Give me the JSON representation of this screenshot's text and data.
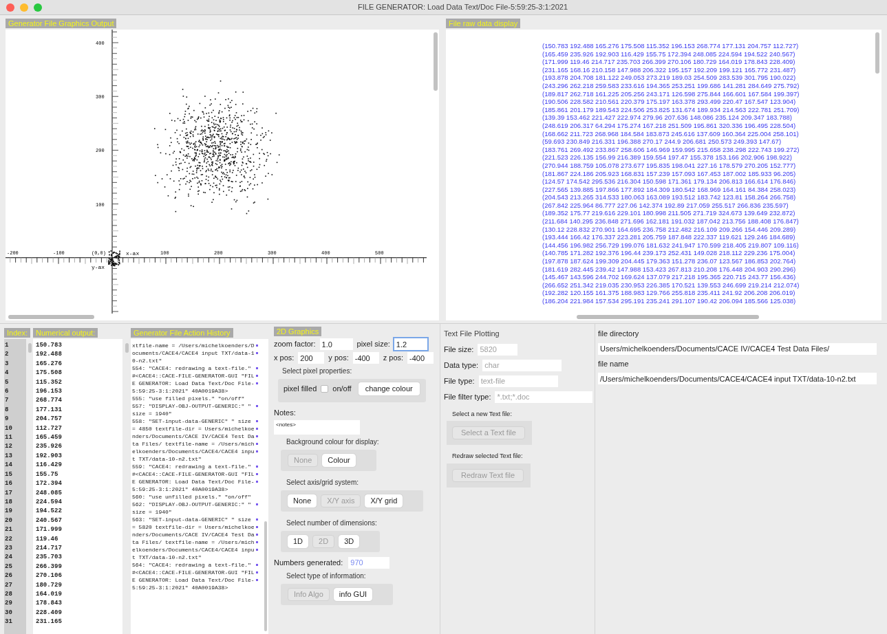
{
  "window": {
    "title": "FILE GENERATOR: Load Data Text/Doc File-5:59:25-3:1:2021"
  },
  "graphics": {
    "title": "Generator File Graphics Output",
    "x_tick_labels": [
      "-200",
      "-100",
      "100",
      "200",
      "300",
      "400",
      "500"
    ],
    "y_tick_labels": [
      "400",
      "300",
      "200",
      "100"
    ],
    "origin_label": "(0,0)",
    "x_axis_label": "x-ax",
    "y_axis_label": "y-ax"
  },
  "raw_data": {
    "title": "File raw data display",
    "lines": [
      "(150.783 192.488 165.276 175.508 115.352 196.153 268.774 177.131 204.757 112.727)",
      "(165.459 235.926 192.903 116.429 155.75 172.394 248.085 224.594 194.522 240.567)",
      "(171.999 119.46 214.717 235.703 266.399 270.106 180.729 164.019 178.843 228.409)",
      "(231.165 168.16 210.158 147.988 206.322 195.157 192.209 199.121 165.772 231.487)",
      "(193.878 204.708 181.122 249.053 273.219 189.03 254.509 283.539 301.795 190.022)",
      "(243.296 262.218 259.583 233.616 194.365 253.251 199.686 141.281 284.649 275.792)",
      "(189.817 262.718 161.225 205.256 243.171 126.598 275.844 166.601 167.584 199.397)",
      "(190.506 228.582 210.561 220.379 175.197 163.378 293.499 220.47 167.547 123.904)",
      "(185.861 201.179 189.543 224.506 253.825 131.674 189.934 214.563 222.781 251.709)",
      "(139.39 153.462 221.427 222.974 279.96 207.636 148.086 235.124 209.347 183.788)",
      "(248.619 206.317 64.294 175.274 167.218 251.509 195.861 320.336 196.495 228.504)",
      "(168.662 211.723 268.968 184.584 183.873 245.616 137.609 160.364 225.004 258.101)",
      "(59.693 230.849 216.331 196.388 270.17 244.9 206.681 250.573 249.393 147.67)",
      "(183.761 269.492 233.867 258.606 146.969 159.995 215.658 238.298 222.743 199.272)",
      "(221.523 226.135 156.99 216.389 159.554 197.47 155.378 153.166 202.906 198.922)",
      "(270.944 188.759 105.078 273.677 195.835 198.041 227.16 178.579 270.205 152.777)",
      "(181.867 224.186 205.923 168.831 157.239 157.093 167.453 187.002 185.933 96.205)",
      "(124.57 174.542 295.536 216.304 150.598 171.361 179.134 206.813 166.614 176.846)",
      "(227.565 139.885 197.866 177.892 184.309 180.542 168.969 164.161 84.384 258.023)",
      "(204.543 213.265 314.533 180.063 163.089 193.512 183.742 123.81 158.264 266.758)",
      "(267.842 225.964 86.777 227.06 142.374 192.89 217.059 255.517 266.836 235.597)",
      "(189.352 175.77 219.616 229.101 180.998 211.505 271.719 324.673 139.649 232.872)",
      "(211.684 140.295 236.848 271.696 162.181 191.032 187.042 213.756 188.408 176.847)",
      "(130.12 228.832 270.901 164.695 236.758 212.482 216.109 209.266 154.446 209.289)",
      "(193.444 166.42 176.337 223.281 205.759 187.848 222.337 119.621 129.246 184.689)",
      "(144.456 196.982 256.729 199.076 181.632 241.947 170.599 218.405 219.807 109.116)",
      "(140.785 171.282 192.376 196.44 239.173 252.431 149.028 218.112 229.236 175.004)",
      "(197.878 187.624 199.309 204.445 179.363 151.278 236.07 123.567 186.853 202.764)",
      "(181.619 282.445 239.42 147.988 153.423 267.813 210.208 176.448 204.903 290.296)",
      "(145.467 143.596 244.702 169.624 137.079 217.218 195.365 220.715 243.77 156.436)",
      "(266.652 251.342 219.035 230.953 226.385 170.521 139.553 246.699 219.214 212.074)",
      "(192.282 120.155 161.375 188.983 129.766 255.818 235.411 241.92 206.208 206.019)",
      "(186.204 221.984 157.534 295.191 235.241 291.107 190.42 206.094 185.566 125.038)"
    ]
  },
  "output": {
    "index_title": "Index:",
    "values_title": "Numerical output:",
    "rows": [
      {
        "index": "1",
        "value": "150.783"
      },
      {
        "index": "2",
        "value": "192.488"
      },
      {
        "index": "3",
        "value": "165.276"
      },
      {
        "index": "4",
        "value": "175.508"
      },
      {
        "index": "5",
        "value": "115.352"
      },
      {
        "index": "6",
        "value": "196.153"
      },
      {
        "index": "7",
        "value": "268.774"
      },
      {
        "index": "8",
        "value": "177.131"
      },
      {
        "index": "9",
        "value": "204.757"
      },
      {
        "index": "10",
        "value": "112.727"
      },
      {
        "index": "11",
        "value": "165.459"
      },
      {
        "index": "12",
        "value": "235.926"
      },
      {
        "index": "13",
        "value": "192.903"
      },
      {
        "index": "14",
        "value": "116.429"
      },
      {
        "index": "15",
        "value": "155.75"
      },
      {
        "index": "16",
        "value": "172.394"
      },
      {
        "index": "17",
        "value": "248.085"
      },
      {
        "index": "18",
        "value": "224.594"
      },
      {
        "index": "19",
        "value": "194.522"
      },
      {
        "index": "20",
        "value": "240.567"
      },
      {
        "index": "21",
        "value": "171.999"
      },
      {
        "index": "22",
        "value": "119.46"
      },
      {
        "index": "23",
        "value": "214.717"
      },
      {
        "index": "24",
        "value": "235.703"
      },
      {
        "index": "25",
        "value": "266.399"
      },
      {
        "index": "26",
        "value": "270.106"
      },
      {
        "index": "27",
        "value": "180.729"
      },
      {
        "index": "28",
        "value": "164.019"
      },
      {
        "index": "29",
        "value": "178.843"
      },
      {
        "index": "30",
        "value": "228.409"
      },
      {
        "index": "31",
        "value": "231.165"
      }
    ]
  },
  "history": {
    "title": "Generator File Action History",
    "lines": [
      {
        "text": "xtfile-name = /Users/michelkoenders/D",
        "wrapped": true
      },
      {
        "text": "ocuments/CACE4/CACE4 input TXT/data-1",
        "wrapped": true
      },
      {
        "text": "0-n2.txt\"",
        "wrapped": false
      },
      {
        "text": "554: \"CACE4: redrawing a text-file.\"",
        "wrapped": true
      },
      {
        "text": "#<CACE4::CACE-FILE-GENERATOR-GUI \"FIL",
        "wrapped": true
      },
      {
        "text": "E GENERATOR: Load Data Text/Doc File-",
        "wrapped": true
      },
      {
        "text": "5:59:25-3:1:2021\" 40A0019A38>",
        "wrapped": false
      },
      {
        "text": "555: \"use filled pixels.\" \"on/off\"",
        "wrapped": false
      },
      {
        "text": "557: \"DISPLAY-OBJ-OUTPUT-GENERIC:\" \"",
        "wrapped": true
      },
      {
        "text": "size = 1940\"",
        "wrapped": false
      },
      {
        "text": "558: \"SET-input-data-GENERIC\" \" size",
        "wrapped": true
      },
      {
        "text": "= 4850 textfile-dir = Users/michelkoe",
        "wrapped": true
      },
      {
        "text": "nders/Documents/CACE IV/CACE4 Test Da",
        "wrapped": true
      },
      {
        "text": "ta Files/ textfile-name = /Users/mich",
        "wrapped": true
      },
      {
        "text": "elkoenders/Documents/CACE4/CACE4 inpu",
        "wrapped": true
      },
      {
        "text": "t TXT/data-10-n2.txt\"",
        "wrapped": false
      },
      {
        "text": "559: \"CACE4: redrawing a text-file.\"",
        "wrapped": true
      },
      {
        "text": "#<CACE4::CACE-FILE-GENERATOR-GUI \"FIL",
        "wrapped": true
      },
      {
        "text": "E GENERATOR: Load Data Text/Doc File-",
        "wrapped": true
      },
      {
        "text": "5:59:25-3:1:2021\" 40A0019A38>",
        "wrapped": false
      },
      {
        "text": "560: \"use unfilled pixels.\" \"on/off\"",
        "wrapped": false
      },
      {
        "text": "562: \"DISPLAY-OBJ-OUTPUT-GENERIC:\" \"",
        "wrapped": true
      },
      {
        "text": "size = 1940\"",
        "wrapped": false
      },
      {
        "text": "563: \"SET-input-data-GENERIC\" \" size",
        "wrapped": true
      },
      {
        "text": "= 5820 textfile-dir = Users/michelkoe",
        "wrapped": true
      },
      {
        "text": "nders/Documents/CACE IV/CACE4 Test Da",
        "wrapped": true
      },
      {
        "text": "ta Files/ textfile-name = /Users/mich",
        "wrapped": true
      },
      {
        "text": "elkoenders/Documents/CACE4/CACE4 inpu",
        "wrapped": true
      },
      {
        "text": "t TXT/data-10-n2.txt\"",
        "wrapped": false
      },
      {
        "text": "564: \"CACE4: redrawing a text-file.\"",
        "wrapped": true
      },
      {
        "text": "#<CACE4::CACE-FILE-GENERATOR-GUI \"FIL",
        "wrapped": true
      },
      {
        "text": "E GENERATOR: Load Data Text/Doc File-",
        "wrapped": true
      },
      {
        "text": "5:59:25-3:1:2021\" 40A0019A38>",
        "wrapped": false
      }
    ]
  },
  "graphics_2d": {
    "title": "2D Graphics",
    "field_rows": [
      [
        {
          "label": "zoom factor:",
          "value": "1.0",
          "focused": false
        },
        {
          "label": "pixel size:",
          "value": "1.2",
          "focused": true
        }
      ],
      [
        {
          "label": "x pos:",
          "value": "200",
          "focused": false
        },
        {
          "label": "y pos:",
          "value": "-400",
          "focused": false
        },
        {
          "label": "z pos:",
          "value": "-400",
          "focused": false
        }
      ]
    ],
    "pixel": {
      "caption": "Select pixel properties:",
      "label": "pixel filled",
      "checked": false,
      "checkbox_text": "on/off",
      "button": "change colour"
    },
    "notes": {
      "label": "Notes:",
      "value": "<notes>"
    },
    "groups": [
      {
        "caption": "Background colour for display:",
        "buttons": [
          {
            "label": "None",
            "disabled": true
          },
          {
            "label": "Colour",
            "disabled": false
          }
        ]
      },
      {
        "caption": "Select axis/grid system:",
        "buttons": [
          {
            "label": "None",
            "disabled": false
          },
          {
            "label": "X/Y axis",
            "disabled": true
          },
          {
            "label": "X/Y grid",
            "disabled": false
          }
        ]
      },
      {
        "caption": "Select number of dimensions:",
        "buttons": [
          {
            "label": "1D",
            "disabled": false
          },
          {
            "label": "2D",
            "disabled": true
          },
          {
            "label": "3D",
            "disabled": false
          }
        ]
      }
    ],
    "numbers": {
      "label": "Numbers generated:",
      "value": "970"
    },
    "info_group": {
      "caption": "Select type of information:",
      "buttons": [
        {
          "label": "Info Algo",
          "disabled": true
        },
        {
          "label": "info GUI",
          "disabled": false
        }
      ]
    }
  },
  "text_plotting": {
    "title": "Text File Plotting",
    "fields": [
      {
        "label": "File size:",
        "value": "5820"
      },
      {
        "label": "Data type:",
        "value": "char"
      },
      {
        "label": "File type:",
        "value": "text-file"
      },
      {
        "label": "File filter type:",
        "value": "*.txt;*.doc"
      }
    ],
    "actions": [
      {
        "caption": "Select a new Text file:",
        "label": "Select a Text file",
        "disabled": true
      },
      {
        "caption": "Redraw selected Text file:",
        "label": "Redraw Text file",
        "disabled": true
      }
    ]
  },
  "file_info": {
    "fields": [
      {
        "label": "file directory",
        "value": "Users/michelkoenders/Documents/CACE IV/CACE4 Test Data Files/"
      },
      {
        "label": "file name",
        "value": "/Users/michelkoenders/Documents/CACE4/CACE4 input TXT/data-10-n2.txt"
      }
    ]
  }
}
